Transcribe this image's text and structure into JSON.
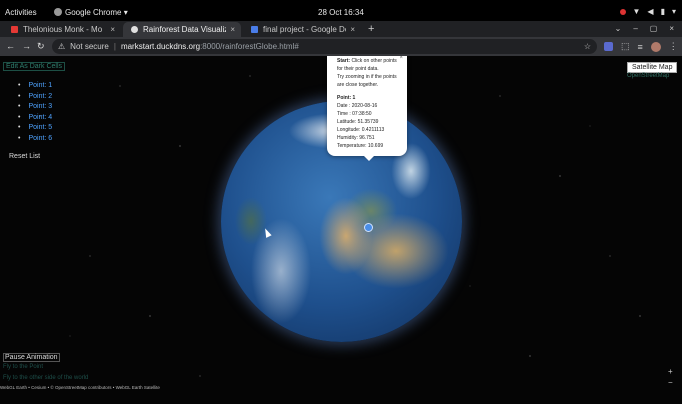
{
  "system_bar": {
    "activities": "Activities",
    "app_name": "Google Chrome",
    "app_menu_arrow": "▾",
    "clock": "28 Oct  16:34",
    "tray_icons": [
      "record-indicator",
      "wifi-icon",
      "volume-icon",
      "battery-icon",
      "power-menu-icon"
    ],
    "tray_arrow": "▾"
  },
  "browser": {
    "tabs": [
      {
        "title": "Thelonious Monk - Mo",
        "favicon_color": "#e53935",
        "active": false,
        "close": "×"
      },
      {
        "title": "Rainforest Data Visualiz",
        "favicon_color": "#e0e0e0",
        "active": true,
        "close": "×"
      },
      {
        "title": "final project - Google Doc",
        "favicon_color": "#4a7de8",
        "active": false,
        "close": "×"
      }
    ],
    "new_tab": "+",
    "window_controls": [
      "⌄",
      "–",
      "▢",
      "×"
    ],
    "nav": {
      "back": "←",
      "forward": "→",
      "reload": "↻"
    },
    "omnibox": {
      "security_icon": "⚠",
      "security_text": "Not secure",
      "separator": "|",
      "url_host": "markstart.duckdns.org",
      "url_rest": ":8000/rainforestGlobe.html#",
      "bookmark": "☆"
    },
    "toolbar_right": {
      "extensions": "⬚",
      "queue": "≡",
      "menu": "⋮"
    }
  },
  "app": {
    "export_button": "Edit As Dark Cells",
    "points": [
      "Point: 1",
      "Point: 2",
      "Point: 3",
      "Point: 4",
      "Point: 5",
      "Point: 6"
    ],
    "reset_list": "Reset List",
    "popup": {
      "close": "×",
      "intro_label": "Start:",
      "intro_lines": [
        "Click on other points",
        "for their point data.",
        "Try zooming in if the points",
        "are close together."
      ],
      "point_title": "Point: 1",
      "fields": [
        "Date : 2020-08-16",
        "Time : 07:38:50",
        "Latitude: 51.35739",
        "Longitude: 0.4211113",
        "Humidity: 96.751",
        "Temperature: 10.699"
      ]
    },
    "satellite_button": "Satellite Map",
    "osm_link": "OpenStreetMap",
    "pause_button": "Pause Animation",
    "faint_link_1": "Fly to the Point",
    "faint_link_2": "Fly to the other side of the world",
    "credit": "WebGL Earth • Cesium • © OpenStreetMap contributors • WebGL Earth Satellite",
    "zoom_in": "+",
    "zoom_out": "−"
  }
}
